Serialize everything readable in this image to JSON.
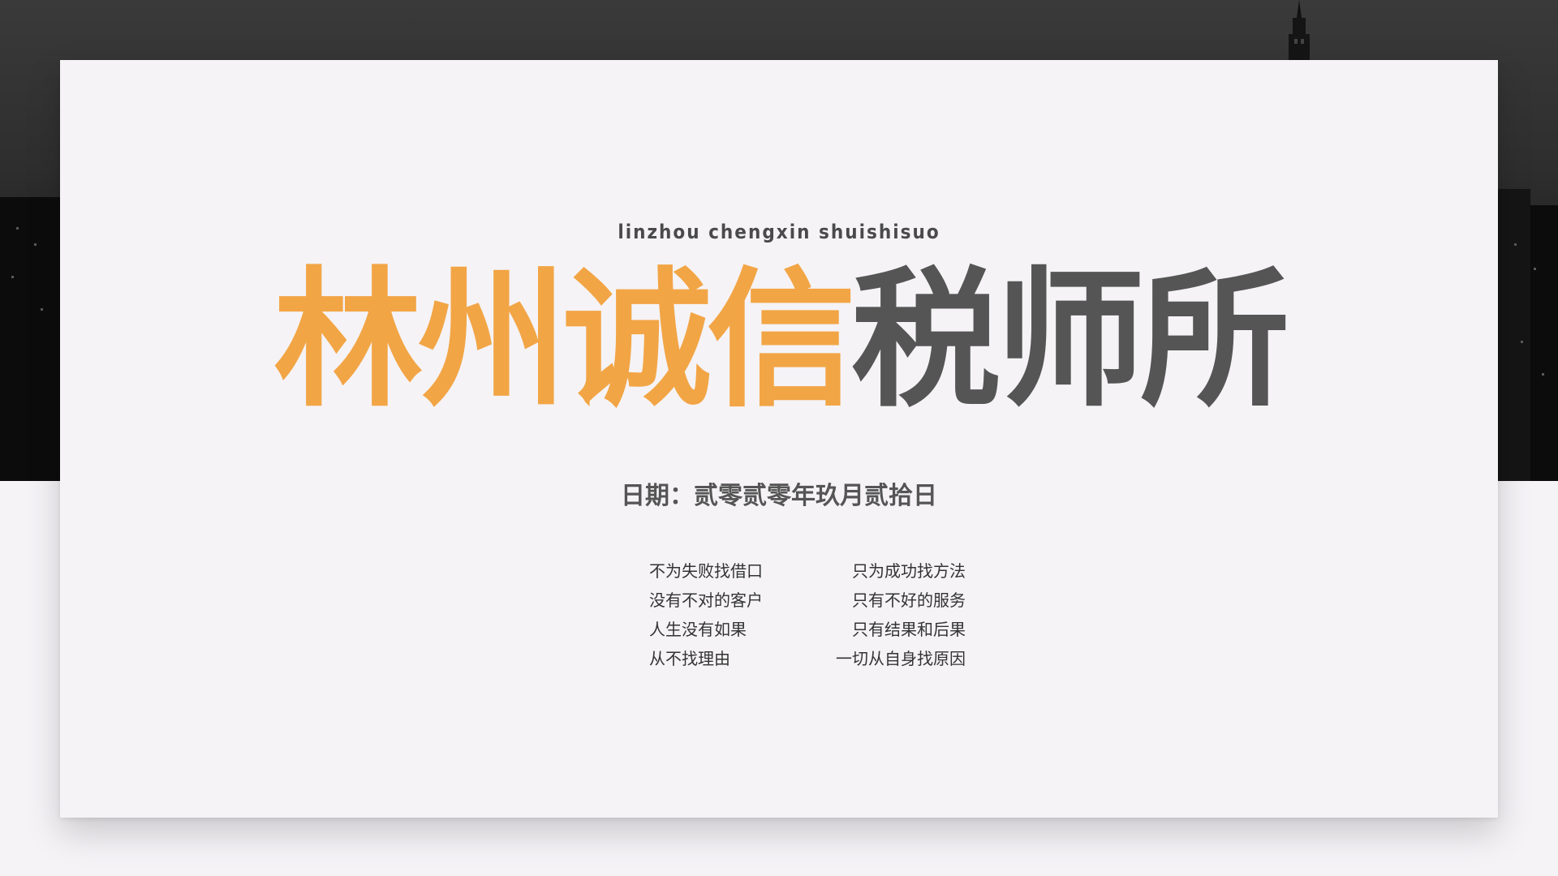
{
  "slide": {
    "subtitle_en": "linzhou chengxin shuishisuo",
    "title_accent": "林州诚信",
    "title_dark": "税师所",
    "date_line": "日期：贰零贰零年玖月贰拾日",
    "mottos": [
      {
        "left": "不为失败找借口",
        "right": "只为成功找方法"
      },
      {
        "left": "没有不对的客户",
        "right": "只有不好的服务"
      },
      {
        "left": "人生没有如果",
        "right": "只有结果和后果"
      },
      {
        "left": "从不找理由",
        "right": "一切从自身找原因"
      }
    ]
  },
  "colors": {
    "accent": "#f2a545",
    "dark_text": "#555555",
    "background": "#f5f3f6",
    "backdrop": "#2e2e2e"
  }
}
